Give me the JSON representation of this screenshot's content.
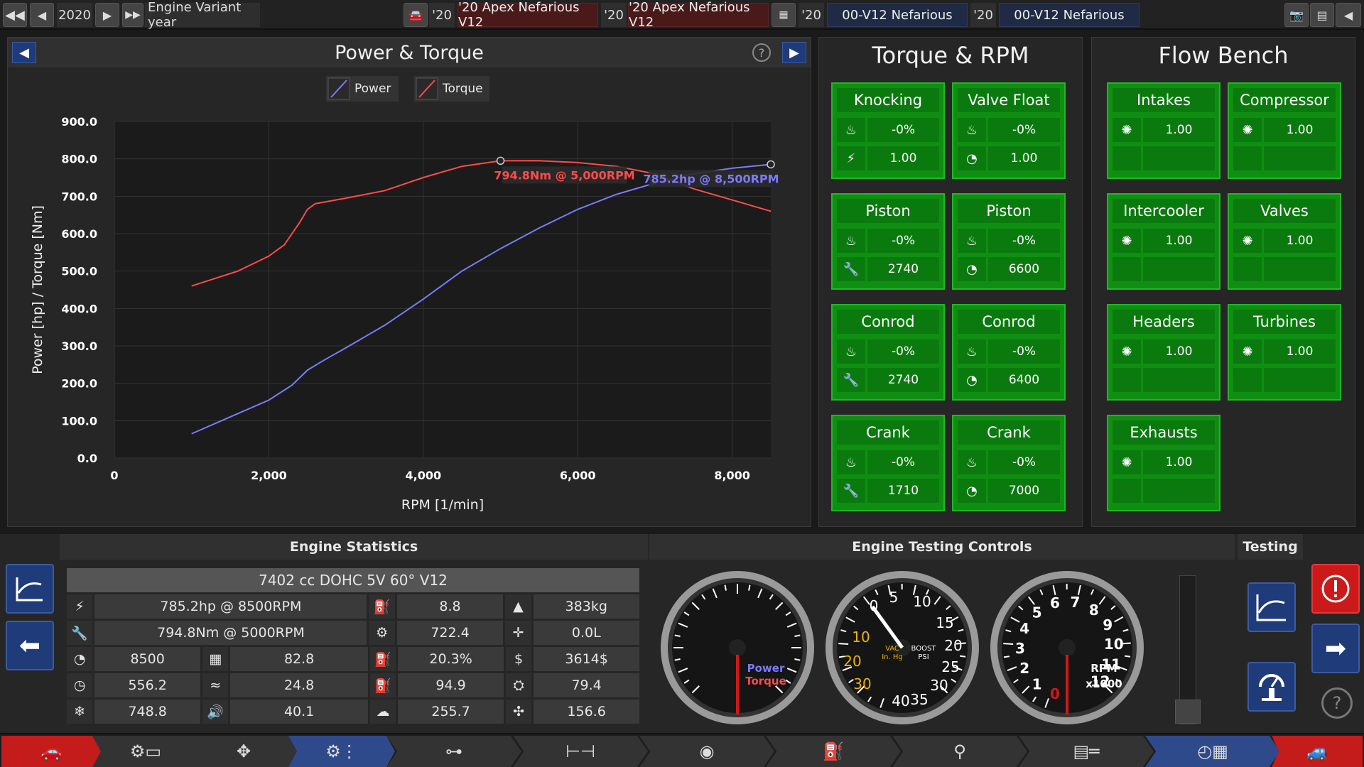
{
  "topbar": {
    "year": "2020",
    "year_label": "Engine Variant year",
    "slots": [
      {
        "year": "'20",
        "name": "'20 Apex Nefarious V12"
      },
      {
        "year": "'20",
        "name": "'20 Apex Nefarious V12"
      },
      {
        "year": "'20",
        "name": "00-V12 Nefarious"
      },
      {
        "year": "'20",
        "name": "00-V12 Nefarious"
      }
    ]
  },
  "chart_panel": {
    "title": "Power & Torque",
    "legend_power": "Power",
    "legend_torque": "Torque"
  },
  "chart_data": {
    "type": "line",
    "xlabel": "RPM [1/min]",
    "ylabel": "Power [hp] / Torque [Nm]",
    "xlim": [
      0,
      8500
    ],
    "ylim": [
      0,
      900
    ],
    "xticks": [
      "0",
      "2,000",
      "4,000",
      "6,000",
      "8,000"
    ],
    "yticks": [
      "0.0",
      "100.0",
      "200.0",
      "300.0",
      "400.0",
      "500.0",
      "600.0",
      "700.0",
      "800.0",
      "900.0"
    ],
    "colors": {
      "power": "#7b7bff",
      "torque": "#ff4b4b"
    },
    "series": [
      {
        "name": "Power",
        "x": [
          1000,
          1500,
          2000,
          2300,
          2500,
          2700,
          3000,
          3500,
          4000,
          4500,
          5000,
          5500,
          6000,
          6500,
          7000,
          7500,
          8000,
          8500
        ],
        "y": [
          65,
          110,
          155,
          195,
          235,
          260,
          295,
          355,
          425,
          500,
          560,
          615,
          665,
          705,
          735,
          760,
          775,
          785.2
        ]
      },
      {
        "name": "Torque",
        "x": [
          1000,
          1300,
          1600,
          2000,
          2200,
          2400,
          2500,
          2600,
          3000,
          3500,
          4000,
          4500,
          5000,
          5500,
          6000,
          6500,
          7000,
          7500,
          8000,
          8500
        ],
        "y": [
          460,
          480,
          500,
          540,
          570,
          630,
          665,
          680,
          695,
          715,
          750,
          780,
          794.8,
          795,
          790,
          780,
          760,
          720,
          690,
          660
        ]
      }
    ],
    "annotations": [
      {
        "text": "794.8Nm @ 5,000RPM",
        "x": 5000,
        "y": 794.8,
        "color": "#ff4b4b"
      },
      {
        "text": "785.2hp @ 8,500RPM",
        "x": 8500,
        "y": 785.2,
        "color": "#7b7bff"
      }
    ]
  },
  "torque_rpm": {
    "title": "Torque & RPM",
    "cards": [
      {
        "title": "Knocking",
        "v1": "-0%",
        "v2": "1.00"
      },
      {
        "title": "Valve Float",
        "v1": "-0%",
        "v2": "1.00"
      },
      {
        "title": "Piston",
        "v1": "-0%",
        "v2": "2740"
      },
      {
        "title": "Piston",
        "v1": "-0%",
        "v2": "6600"
      },
      {
        "title": "Conrod",
        "v1": "-0%",
        "v2": "2740"
      },
      {
        "title": "Conrod",
        "v1": "-0%",
        "v2": "6400"
      },
      {
        "title": "Crank",
        "v1": "-0%",
        "v2": "1710"
      },
      {
        "title": "Crank",
        "v1": "-0%",
        "v2": "7000"
      }
    ]
  },
  "flow_bench": {
    "title": "Flow Bench",
    "cards": [
      {
        "title": "Intakes",
        "v1": "1.00"
      },
      {
        "title": "Compressor",
        "v1": "1.00"
      },
      {
        "title": "Intercooler",
        "v1": "1.00"
      },
      {
        "title": "Valves",
        "v1": "1.00"
      },
      {
        "title": "Headers",
        "v1": "1.00"
      },
      {
        "title": "Turbines",
        "v1": "1.00"
      },
      {
        "title": "Exhausts",
        "v1": "1.00"
      }
    ]
  },
  "stats": {
    "title": "Engine Statistics",
    "engine": "7402 cc DOHC 5V 60° V12",
    "power": "785.2hp @ 8500RPM",
    "torque": "794.8Nm @ 5000RPM",
    "c1": [
      "8500",
      "556.2",
      "748.8"
    ],
    "c2": [
      "82.8",
      "24.8",
      "40.1"
    ],
    "c3": [
      "8.8",
      "722.4",
      "20.3%",
      "94.9",
      "255.7"
    ],
    "c4": [
      "383kg",
      "0.0L",
      "3614$",
      "79.4",
      "156.6"
    ]
  },
  "controls": {
    "title": "Engine Testing Controls",
    "gauge1_power": "Power",
    "gauge1_torque": "Torque",
    "vac_label": "VAC",
    "vac_unit": "In. Hg",
    "boost_label": "BOOST",
    "boost_unit": "PSI",
    "vac_ticks": [
      "0",
      "5",
      "10",
      "15",
      "20",
      "25",
      "30",
      "35",
      "40",
      "30",
      "20",
      "10"
    ],
    "rpm_label": "RPM",
    "rpm_unit": "x1000",
    "rpm_ticks": [
      "0",
      "1",
      "2",
      "3",
      "4",
      "5",
      "6",
      "7",
      "8",
      "9",
      "10",
      "11",
      "12"
    ]
  },
  "testing": {
    "title": "Testing"
  }
}
